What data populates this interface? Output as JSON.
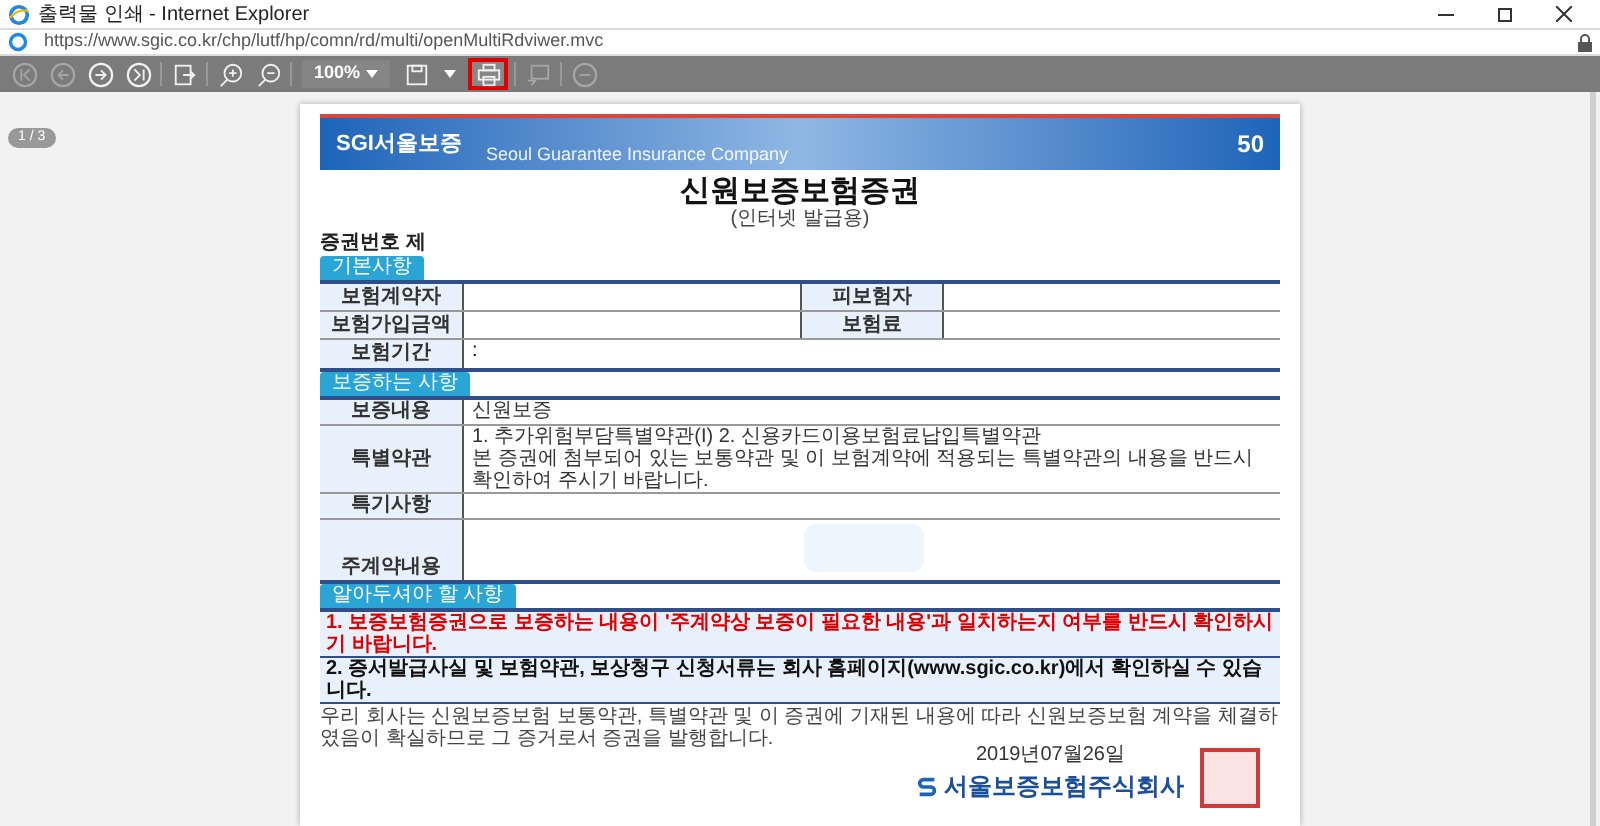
{
  "window": {
    "title": "출력물 인쇄 - Internet Explorer",
    "url": "https://www.sgic.co.kr/chp/lutf/hp/comn/rd/multi/openMultiRdviwer.mvc"
  },
  "toolbar": [
    {
      "kind": "first",
      "disabled": true,
      "highlighted": false
    },
    {
      "kind": "prev",
      "disabled": true,
      "highlighted": false
    },
    {
      "kind": "next",
      "disabled": false,
      "highlighted": false
    },
    {
      "kind": "last",
      "disabled": false,
      "highlighted": false
    },
    {
      "kind": "export",
      "disabled": false,
      "highlighted": false
    },
    {
      "kind": "zoom-in",
      "disabled": false,
      "highlighted": false
    },
    {
      "kind": "zoom-out",
      "disabled": false,
      "highlighted": false
    },
    {
      "kind": "zoom",
      "label": "100%",
      "disabled": false,
      "highlighted": false
    },
    {
      "kind": "save",
      "disabled": false,
      "highlighted": false
    },
    {
      "kind": "print",
      "disabled": false,
      "highlighted": true
    },
    {
      "kind": "comment",
      "disabled": true,
      "highlighted": false
    },
    {
      "kind": "minus",
      "disabled": true,
      "highlighted": false
    }
  ],
  "page_indicator": "1 / 3",
  "document": {
    "banner": {
      "logo": "SGI서울보증",
      "tagline": "Seoul Guarantee Insurance Company",
      "anniversary": "50"
    },
    "title": "신원보증보험증권",
    "subtitle": "(인터넷 발급용)",
    "certificate_label": "증권번호 제",
    "basic": {
      "heading": "기본사항",
      "rows": [
        [
          {
            "kind": "label",
            "text": "보험계약자"
          },
          {
            "kind": "value"
          },
          {
            "kind": "label",
            "text": "피보험자"
          },
          {
            "kind": "value"
          }
        ],
        [
          {
            "kind": "label",
            "text": "보험가입금액"
          },
          {
            "kind": "value"
          },
          {
            "kind": "label",
            "text": "보험료"
          },
          {
            "kind": "value"
          }
        ],
        [
          {
            "kind": "label",
            "text": "보험기간"
          },
          {
            "kind": "value",
            "text": ":"
          }
        ]
      ]
    },
    "guarantee": {
      "heading": "보증하는 사항",
      "rows": [
        {
          "label": "보증내용",
          "lines": [
            "신원보증"
          ],
          "tall": false
        },
        {
          "label": "특별약관",
          "lines": [
            "1. 추가위험부담특별약관(I) 2. 신용카드이용보험료납입특별약관",
            "본 증권에 첨부되어 있는 보통약관 및 이 보험계약에 적용되는 특별약관의 내용을 반드시 확인하여 주시기 바랍니다."
          ],
          "tall": false
        },
        {
          "label": "특기사항",
          "lines": [],
          "tall": false
        },
        {
          "label": "주계약내용",
          "lines": [],
          "tall": true
        }
      ]
    },
    "notice": {
      "heading": "알아두셔야 할 사항",
      "items": [
        {
          "kind": "warning",
          "text": "1. 보증보험증권으로 보증하는 내용이 '주계약상 보증이 필요한 내용'과 일치하는지 여부를 반드시 확인하시기 바랍니다."
        },
        {
          "kind": "bold",
          "text": "2. 증서발급사실 및 보험약관, 보상청구 신청서류는 회사 홈페이지(www.sgic.co.kr)에서 확인하실 수 있습니다."
        }
      ]
    },
    "statement": "우리 회사는 신원보증보험 보통약관, 특별약관 및 이 증권에 기재된 내용에 따라 신원보증보험 계약을 체결하였음이 확실하므로 그 증거로서 증권을 발행합니다.",
    "date": "2019년07월26일",
    "company": "서울보증보험주식회사"
  }
}
